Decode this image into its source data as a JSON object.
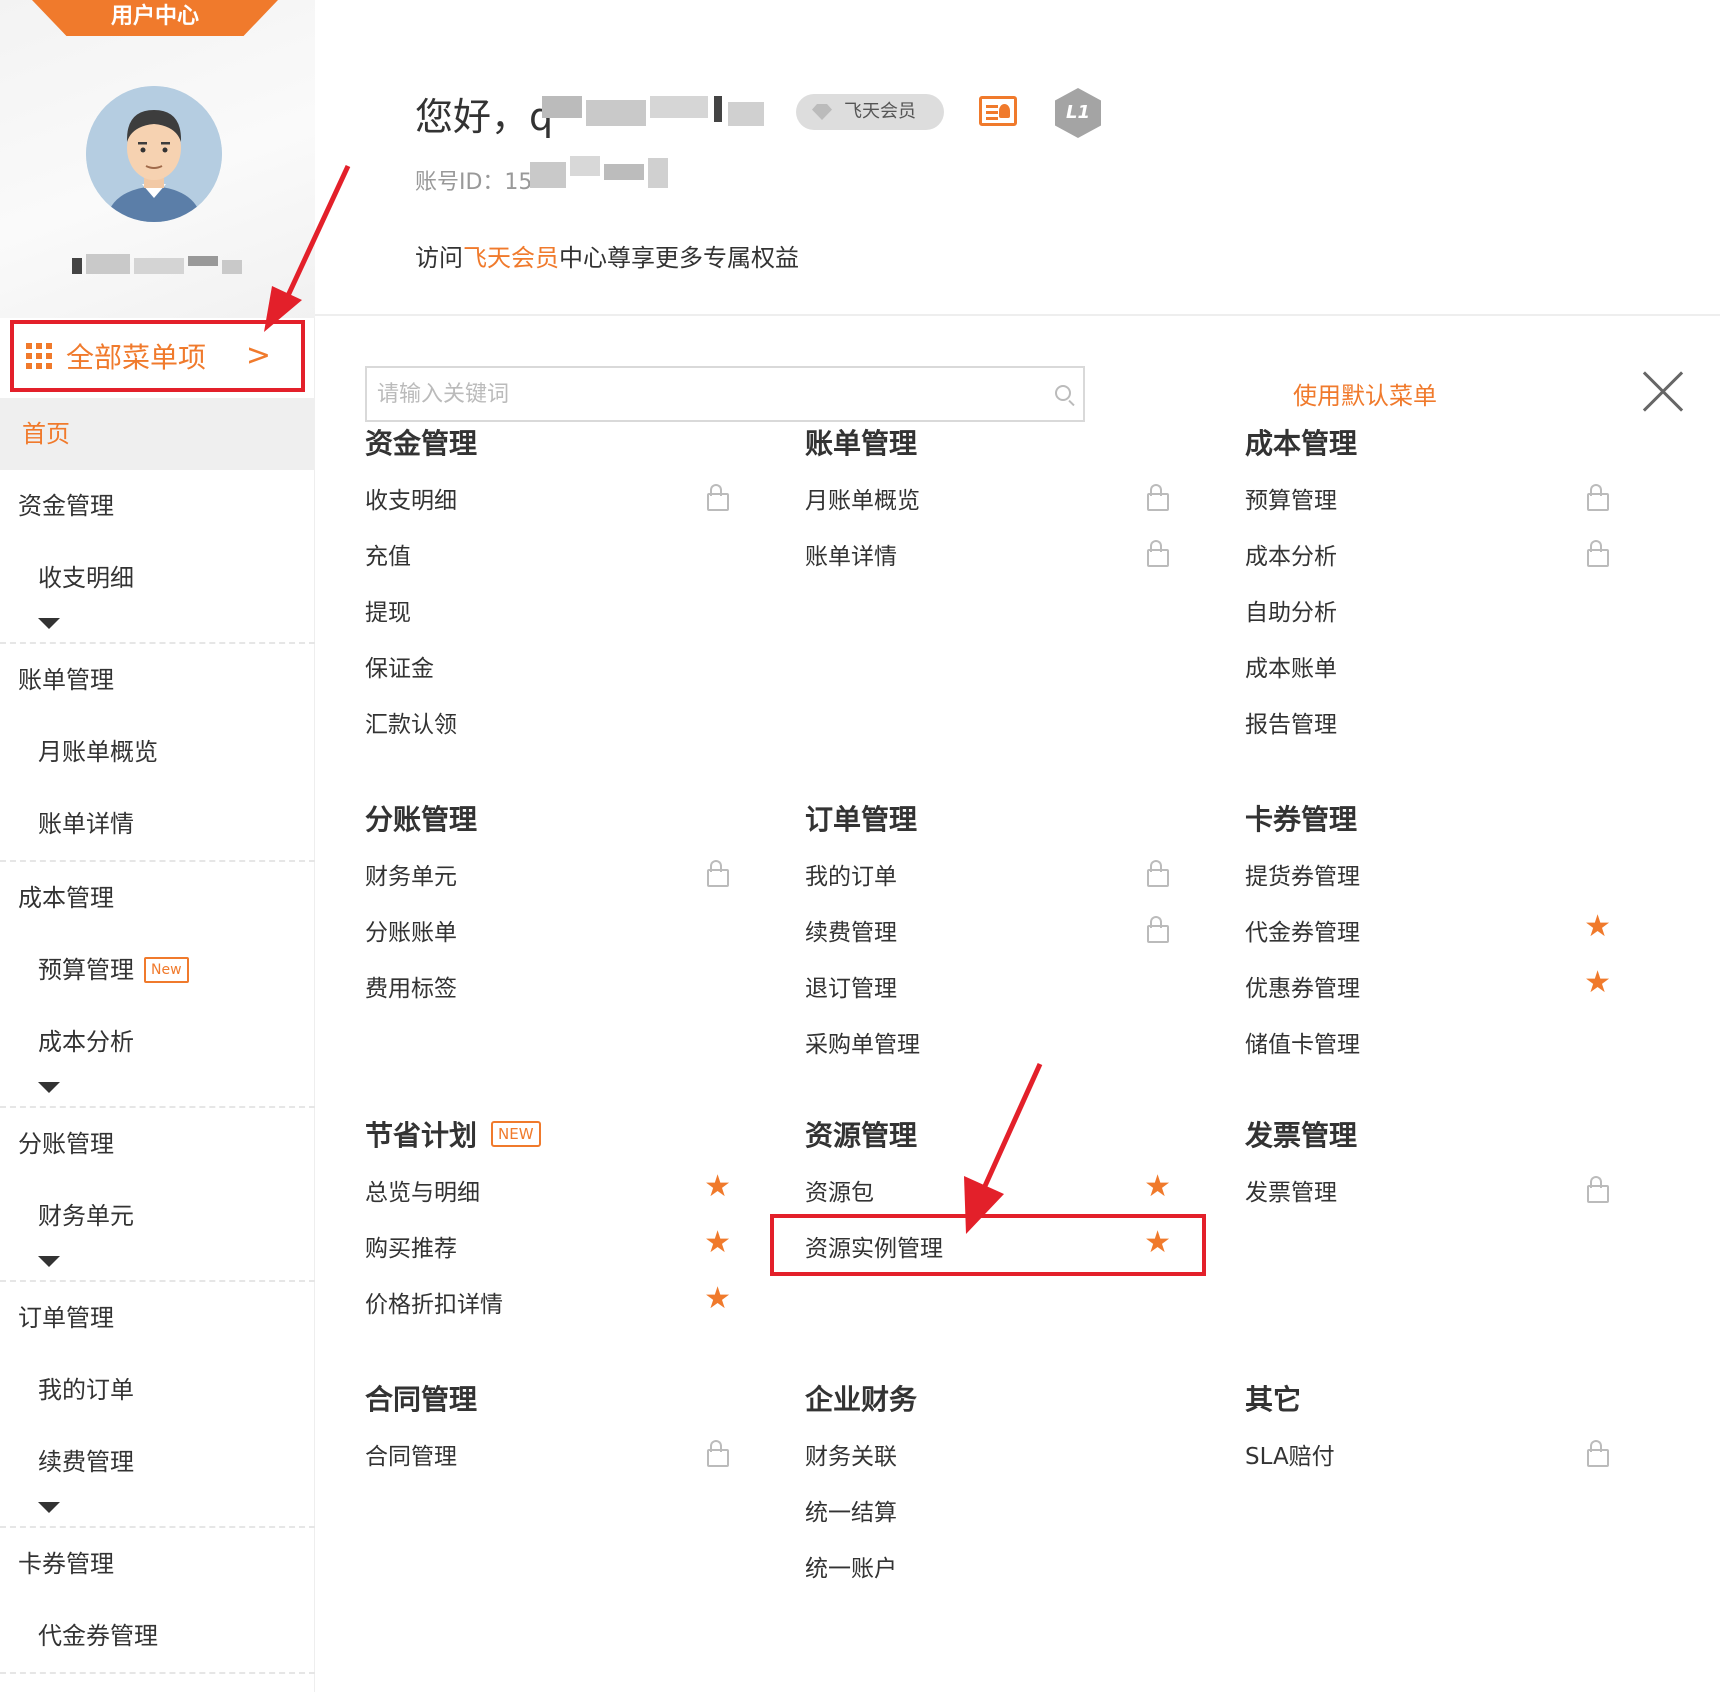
{
  "sidebar": {
    "tab_label": "用户中心",
    "all_menu_label": "全部菜单项",
    "home_label": "首页",
    "groups": [
      {
        "title": "资金管理",
        "items": [
          {
            "label": "收支明细"
          }
        ],
        "caret": true
      },
      {
        "title": "账单管理",
        "items": [
          {
            "label": "月账单概览"
          },
          {
            "label": "账单详情"
          }
        ],
        "caret": false
      },
      {
        "title": "成本管理",
        "items": [
          {
            "label": "预算管理",
            "badge": "New"
          },
          {
            "label": "成本分析"
          }
        ],
        "caret": true
      },
      {
        "title": "分账管理",
        "items": [
          {
            "label": "财务单元"
          }
        ],
        "caret": true
      },
      {
        "title": "订单管理",
        "items": [
          {
            "label": "我的订单"
          },
          {
            "label": "续费管理"
          }
        ],
        "caret": true
      },
      {
        "title": "卡券管理",
        "items": [
          {
            "label": "代金券管理"
          }
        ],
        "caret": false
      }
    ]
  },
  "header": {
    "greeting": "您好，q",
    "member_badge": "飞天会员",
    "level_label": "L1",
    "account_id_label": "账号ID：15",
    "promo_prefix": "访问",
    "promo_link": "飞天会员",
    "promo_suffix": "中心尊享更多专属权益"
  },
  "menu": {
    "search_placeholder": "请输入关键词",
    "default_menu_label": "使用默认菜单",
    "sections": [
      {
        "title": "资金管理",
        "items": [
          {
            "label": "收支明细",
            "icon": "lock"
          },
          {
            "label": "充值"
          },
          {
            "label": "提现"
          },
          {
            "label": "保证金"
          },
          {
            "label": "汇款认领"
          }
        ]
      },
      {
        "title": "账单管理",
        "items": [
          {
            "label": "月账单概览",
            "icon": "lock"
          },
          {
            "label": "账单详情",
            "icon": "lock"
          }
        ]
      },
      {
        "title": "成本管理",
        "items": [
          {
            "label": "预算管理",
            "icon": "lock"
          },
          {
            "label": "成本分析",
            "icon": "lock"
          },
          {
            "label": "自助分析"
          },
          {
            "label": "成本账单"
          },
          {
            "label": "报告管理"
          }
        ]
      },
      {
        "title": "分账管理",
        "items": [
          {
            "label": "财务单元",
            "icon": "lock"
          },
          {
            "label": "分账账单"
          },
          {
            "label": "费用标签"
          }
        ]
      },
      {
        "title": "订单管理",
        "items": [
          {
            "label": "我的订单",
            "icon": "lock"
          },
          {
            "label": "续费管理",
            "icon": "lock"
          },
          {
            "label": "退订管理"
          },
          {
            "label": "采购单管理"
          }
        ]
      },
      {
        "title": "卡券管理",
        "items": [
          {
            "label": "提货券管理"
          },
          {
            "label": "代金券管理",
            "icon": "star"
          },
          {
            "label": "优惠券管理",
            "icon": "star"
          },
          {
            "label": "储值卡管理"
          }
        ]
      },
      {
        "title": "节省计划",
        "badge": "NEW",
        "items": [
          {
            "label": "总览与明细",
            "icon": "star"
          },
          {
            "label": "购买推荐",
            "icon": "star"
          },
          {
            "label": "价格折扣详情",
            "icon": "star"
          }
        ]
      },
      {
        "title": "资源管理",
        "items": [
          {
            "label": "资源包",
            "icon": "star"
          },
          {
            "label": "资源实例管理",
            "icon": "star"
          }
        ]
      },
      {
        "title": "发票管理",
        "items": [
          {
            "label": "发票管理",
            "icon": "lock"
          }
        ]
      },
      {
        "title": "合同管理",
        "items": [
          {
            "label": "合同管理",
            "icon": "lock"
          }
        ]
      },
      {
        "title": "企业财务",
        "items": [
          {
            "label": "财务关联"
          },
          {
            "label": "统一结算"
          },
          {
            "label": "统一账户"
          }
        ]
      },
      {
        "title": "其它",
        "items": [
          {
            "label": "SLA赔付",
            "icon": "lock"
          }
        ]
      }
    ]
  },
  "colors": {
    "accent": "#f07a2c",
    "highlight": "#e3202a"
  }
}
